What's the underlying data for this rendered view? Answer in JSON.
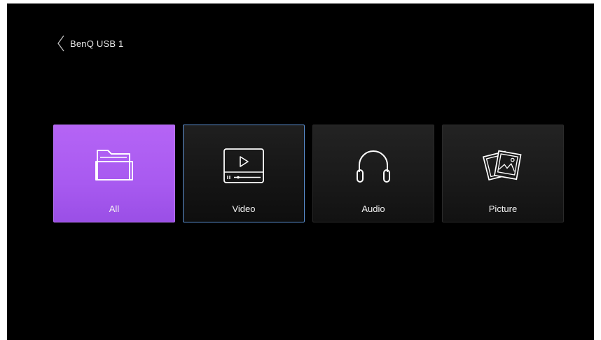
{
  "header": {
    "title": "BenQ USB 1",
    "back_icon": "chevron-left-icon"
  },
  "tiles": [
    {
      "label": "All",
      "icon": "folder-icon",
      "state": "selected",
      "color": "#a95df2"
    },
    {
      "label": "Video",
      "icon": "video-player-icon",
      "state": "focused",
      "color": "#5b8fd0"
    },
    {
      "label": "Audio",
      "icon": "headphones-icon",
      "state": "normal"
    },
    {
      "label": "Picture",
      "icon": "pictures-icon",
      "state": "normal"
    }
  ],
  "colors": {
    "background": "#000000",
    "accent": "#a95df2",
    "focus_border": "#5b8fd0",
    "text": "#f2f2f2"
  }
}
